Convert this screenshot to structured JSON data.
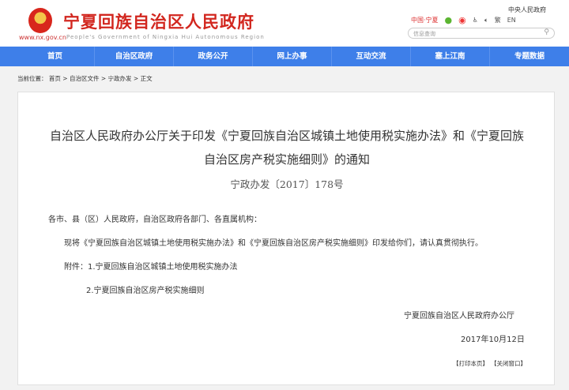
{
  "header": {
    "title": "宁夏回族自治区人民政府",
    "url": "www.nx.gov.cn",
    "title_en": "People's Government of Ningxia Hui Autonomous Region",
    "central_gov": "中央人民政府",
    "china_ningxia": "中国·宁夏",
    "traditional": "繁",
    "english": "EN",
    "search_placeholder": "信息查询"
  },
  "nav": [
    "首页",
    "自治区政府",
    "政务公开",
    "网上办事",
    "互动交流",
    "塞上江南",
    "专题数据"
  ],
  "breadcrumb": {
    "label": "当前位置：",
    "items": [
      "首页",
      "自治区文件",
      "宁政办发",
      "正文"
    ]
  },
  "article": {
    "title_line1": "自治区人民政府办公厅关于印发《宁夏回族自治区城镇土地使用税实施办法》和《宁夏回族",
    "title_line2": "自治区房产税实施细则》的通知",
    "doc_number": "宁政办发〔2017〕178号",
    "salutation": "各市、县（区）人民政府，自治区政府各部门、各直属机构：",
    "body": "现将《宁夏回族自治区城镇土地使用税实施办法》和《宁夏回族自治区房产税实施细则》印发给你们，请认真贯彻执行。",
    "attachment1": "附件：1.宁夏回族自治区城镇土地使用税实施办法",
    "attachment2": "2.宁夏回族自治区房产税实施细则",
    "issuer": "宁夏回族自治区人民政府办公厅",
    "date": "2017年10月12日",
    "print": "【打印本页】",
    "close": "【关闭窗口】"
  }
}
